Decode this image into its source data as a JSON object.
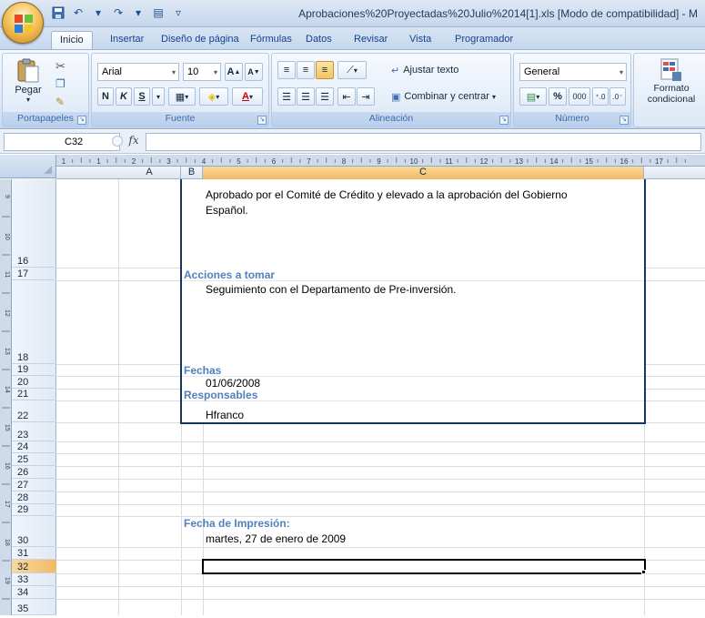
{
  "window": {
    "title": "Aprobaciones%20Proyectadas%20Julio%2014[1].xls  [Modo de compatibilidad] - M"
  },
  "ribbon_tabs": [
    "Inicio",
    "Insertar",
    "Diseño de página",
    "Fórmulas",
    "Datos",
    "Revisar",
    "Vista",
    "Programador"
  ],
  "ribbon": {
    "clipboard": {
      "paste": "Pegar",
      "label": "Portapapeles"
    },
    "font": {
      "name": "Arial",
      "size": "10",
      "bold": "N",
      "italic": "K",
      "underline": "S",
      "label": "Fuente"
    },
    "alignment": {
      "wrap": "Ajustar texto",
      "merge": "Combinar y centrar",
      "label": "Alineación"
    },
    "number": {
      "format": "General",
      "percent": "%",
      "thousands": "000",
      "label": "Número"
    },
    "styles": {
      "conditional_line1": "Formato",
      "conditional_line2": "condicional"
    }
  },
  "formula_bar": {
    "name_box": "C32",
    "fx": "fx",
    "content": ""
  },
  "columns": [
    "A",
    "B",
    "C"
  ],
  "rows": [
    "16",
    "17",
    "18",
    "19",
    "20",
    "21",
    "22",
    "23",
    "24",
    "25",
    "26",
    "27",
    "28",
    "29",
    "30",
    "31",
    "32",
    "33",
    "34",
    "35"
  ],
  "selected_cell": "C32",
  "ruler": {
    "top_marks": [
      "1",
      "1",
      "2",
      "3",
      "4",
      "5",
      "6",
      "7",
      "8",
      "9",
      "10",
      "11",
      "12",
      "13",
      "14",
      "15",
      "16",
      "17"
    ],
    "side_marks": [
      "9",
      "10",
      "11",
      "12",
      "13",
      "14",
      "15",
      "16",
      "17",
      "18",
      "19",
      "20",
      "21"
    ]
  },
  "cells": {
    "c16_text_line1": "Aprobado por el Comité de Crédito y elevado a la aprobación del Gobierno",
    "c16_text_line2": "Español.",
    "b17_header": "Acciones a tomar",
    "c17_text": "Seguimiento con el Departamento de Pre-inversión.",
    "b19_header": "Fechas",
    "c20_value": "01/06/2008",
    "b21_header": "Responsables",
    "c22_value": "Hfranco",
    "b29_header": "Fecha de Impresión:",
    "c30_value": "martes, 27 de enero de 2009"
  },
  "colors": {
    "header_blue": "#4f81bd",
    "border_navy": "#17365d",
    "selected_header": "#f2b964"
  }
}
